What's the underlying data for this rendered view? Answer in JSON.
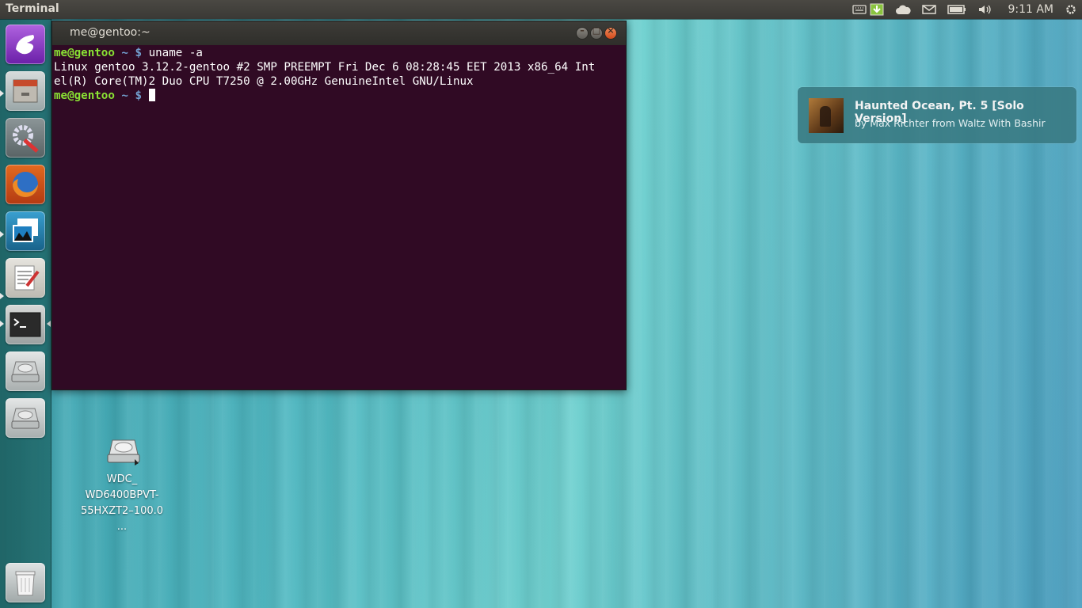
{
  "top_panel": {
    "app_title": "Terminal",
    "clock": "9:11 AM",
    "indicators": [
      "keyboard-icon",
      "download-icon",
      "cloud-icon",
      "mail-icon",
      "battery-icon",
      "volume-icon",
      "gear-icon"
    ]
  },
  "launcher": {
    "items": [
      "dash-home",
      "files",
      "system-settings",
      "firefox",
      "image-viewer",
      "text-editor",
      "terminal",
      "drive-1",
      "drive-2",
      "trash"
    ]
  },
  "terminal": {
    "title": "me@gentoo:~",
    "line1_user": "me@gentoo",
    "line1_path": " ~ $ ",
    "line1_cmd": "uname -a",
    "output_line1": "Linux gentoo 3.12.2-gentoo #2 SMP PREEMPT Fri Dec 6 08:28:45 EET 2013 x86_64 Int",
    "output_line2": "el(R) Core(TM)2 Duo CPU T7250 @ 2.00GHz GenuineIntel GNU/Linux",
    "line3_user": "me@gentoo",
    "line3_path": " ~ $ "
  },
  "notification": {
    "title": "Haunted Ocean, Pt. 5 [Solo Version]",
    "body": "by Max Richter from Waltz With Bashir"
  },
  "desktop": {
    "drive_label_1": "WDC_",
    "drive_label_2": "WD6400BPVT-",
    "drive_label_3": "55HXZT2–100.0 ..."
  },
  "colors": {
    "terminal_bg": "#300a24",
    "prompt_user": "#8ae234",
    "prompt_path": "#729fcf"
  }
}
